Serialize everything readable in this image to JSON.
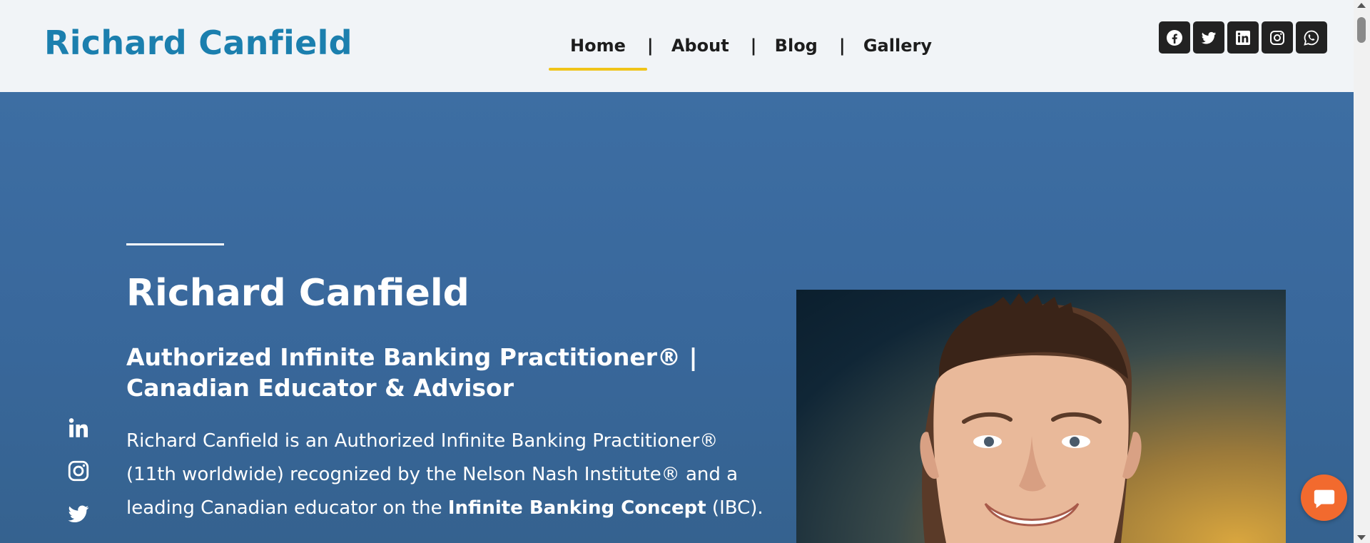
{
  "header": {
    "brand": "Richard Canfield",
    "nav": [
      {
        "label": "Home",
        "active": true
      },
      {
        "label": "About",
        "active": false
      },
      {
        "label": "Blog",
        "active": false
      },
      {
        "label": "Gallery",
        "active": false
      }
    ],
    "separator": "|",
    "social": [
      "facebook-icon",
      "twitter-icon",
      "linkedin-icon",
      "instagram-icon",
      "whatsapp-icon"
    ]
  },
  "hero": {
    "title": "Richard Canfield",
    "subtitle": "Authorized Infinite Banking Practitioner® | Canadian Educator & Advisor",
    "text_before": "Richard Canfield is an Authorized Infinite Banking Practitioner® (11th worldwide) recognized by the Nelson Nash Institute® and a leading Canadian educator on the ",
    "text_bold": "Infinite Banking Concept",
    "text_after": " (IBC).",
    "side_social": [
      "linkedin-icon",
      "instagram-icon",
      "twitter-icon"
    ]
  },
  "colors": {
    "brand": "#1b7fae",
    "nav_active_underline": "#f0c419",
    "hero_bg": "#3d6ea3",
    "chat_button": "#f26a2e",
    "social_button_bg": "#222222"
  }
}
